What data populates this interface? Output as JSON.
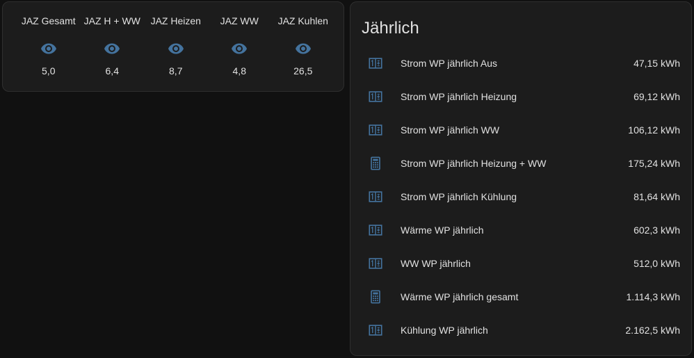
{
  "glance": {
    "items": [
      {
        "name": "JAZ Gesamt",
        "icon": "eye-icon",
        "state": "5,0"
      },
      {
        "name": "JAZ H + WW",
        "icon": "eye-icon",
        "state": "6,4"
      },
      {
        "name": "JAZ Heizen",
        "icon": "eye-icon",
        "state": "8,7"
      },
      {
        "name": "JAZ WW",
        "icon": "eye-icon",
        "state": "4,8"
      },
      {
        "name": "JAZ Kuhlen",
        "icon": "eye-icon",
        "state": "26,5"
      }
    ]
  },
  "entities": {
    "title": "Jährlich",
    "rows": [
      {
        "name": "Strom WP jährlich Aus",
        "value": "47,15 kWh",
        "icon": "meter-icon"
      },
      {
        "name": "Strom WP jährlich Heizung",
        "value": "69,12 kWh",
        "icon": "meter-icon"
      },
      {
        "name": "Strom WP jährlich WW",
        "value": "106,12 kWh",
        "icon": "meter-icon"
      },
      {
        "name": "Strom WP jährlich Heizung + WW",
        "value": "175,24 kWh",
        "icon": "calculator-icon"
      },
      {
        "name": "Strom WP jährlich Kühlung",
        "value": "81,64 kWh",
        "icon": "meter-icon"
      },
      {
        "name": "Wärme WP jährlich",
        "value": "602,3 kWh",
        "icon": "meter-icon"
      },
      {
        "name": "WW WP jährlich",
        "value": "512,0 kWh",
        "icon": "meter-icon"
      },
      {
        "name": "Wärme WP jährlich gesamt",
        "value": "1.114,3 kWh",
        "icon": "calculator-icon"
      },
      {
        "name": "Kühlung WP jährlich",
        "value": "2.162,5 kWh",
        "icon": "meter-icon"
      }
    ]
  },
  "colors": {
    "background": "#111111",
    "card": "#1c1c1c",
    "icon": "#44739e",
    "text": "#e1e1e1"
  }
}
